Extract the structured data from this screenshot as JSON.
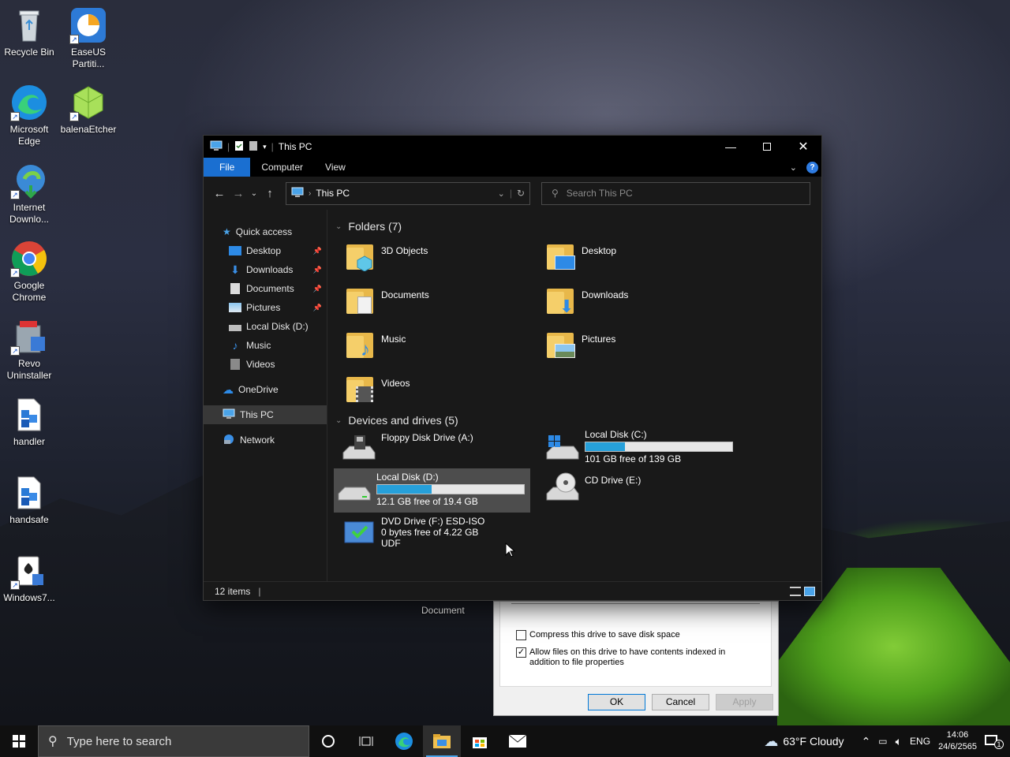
{
  "desktop": {
    "icons": [
      {
        "label": "Recycle Bin"
      },
      {
        "label": "EaseUS Partiti..."
      },
      {
        "label": "Microsoft Edge"
      },
      {
        "label": "balenaEtcher"
      },
      {
        "label": "Internet Downlo..."
      },
      {
        "label": "Google Chrome"
      },
      {
        "label": "Revo Uninstaller"
      },
      {
        "label": "handler"
      },
      {
        "label": "handsafe"
      },
      {
        "label": "Windows7..."
      }
    ],
    "behind_label": "Document"
  },
  "explorer": {
    "title": "This PC",
    "ribbon": {
      "file": "File",
      "computer": "Computer",
      "view": "View",
      "help": "?"
    },
    "address": {
      "location": "This PC"
    },
    "search": {
      "placeholder": "Search This PC"
    },
    "nav": {
      "quick_access": "Quick access",
      "items": [
        {
          "label": "Desktop",
          "pinned": true
        },
        {
          "label": "Downloads",
          "pinned": true
        },
        {
          "label": "Documents",
          "pinned": true
        },
        {
          "label": "Pictures",
          "pinned": true
        },
        {
          "label": "Local Disk (D:)",
          "pinned": false
        },
        {
          "label": "Music",
          "pinned": false
        },
        {
          "label": "Videos",
          "pinned": false
        }
      ],
      "onedrive": "OneDrive",
      "this_pc": "This PC",
      "network": "Network"
    },
    "folders_header": "Folders (7)",
    "folders": [
      "3D Objects",
      "Desktop",
      "Documents",
      "Downloads",
      "Music",
      "Pictures",
      "Videos"
    ],
    "drives_header": "Devices and drives (5)",
    "drives": {
      "floppy": {
        "name": "Floppy Disk Drive (A:)"
      },
      "c": {
        "name": "Local Disk (C:)",
        "free": "101 GB free of 139 GB",
        "used_fraction": 0.27
      },
      "d": {
        "name": "Local Disk (D:)",
        "free": "12.1 GB free of 19.4 GB",
        "used_fraction": 0.37
      },
      "e": {
        "name": "CD Drive (E:)"
      },
      "f": {
        "name": "DVD Drive (F:) ESD-ISO",
        "free": "0 bytes free of 4.22 GB",
        "fs": "UDF"
      }
    },
    "status": "12 items"
  },
  "properties": {
    "compress": "Compress this drive to save disk space",
    "index": "Allow files on this drive to have contents indexed in addition to file properties",
    "ok": "OK",
    "cancel": "Cancel",
    "apply": "Apply"
  },
  "taskbar": {
    "search_placeholder": "Type here to search",
    "weather": "63°F  Cloudy",
    "lang": "ENG",
    "time": "14:06",
    "date": "24/6/2565",
    "notification_count": "1"
  }
}
